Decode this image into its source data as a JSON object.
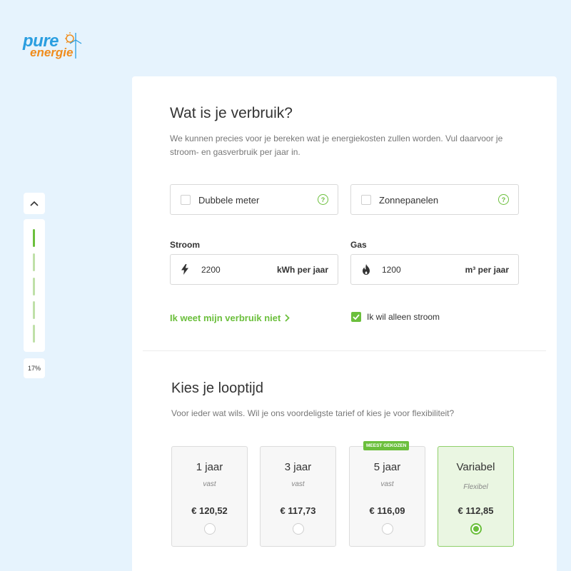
{
  "logo": {
    "line1": "pure",
    "line2": "energie"
  },
  "sidebar": {
    "up_icon": "chevron-up-icon",
    "progress_label": "17%",
    "progress_fraction": 0.17,
    "steps": 5
  },
  "usage": {
    "title": "Wat is je verbruik?",
    "description": "We kunnen precies voor je bereken wat je energiekosten zullen worden. Vul daarvoor je stroom- en gasverbruik per jaar in.",
    "double_meter_label": "Dubbele meter",
    "solar_panels_label": "Zonnepanelen",
    "help_icon_text": "?",
    "stroom": {
      "label": "Stroom",
      "value": "2200",
      "unit": "kWh per jaar",
      "icon": "lightning-icon"
    },
    "gas": {
      "label": "Gas",
      "value": "1200",
      "unit": "m³ per jaar",
      "icon": "flame-icon"
    },
    "unknown_usage_link": "Ik weet mijn verbruik niet",
    "only_electricity_label": "Ik wil alleen stroom",
    "only_electricity_checked": true
  },
  "term": {
    "title": "Kies je looptijd",
    "description": "Voor ieder wat wils. Wil je ons voordeligste tarief of kies je voor flexibiliteit?",
    "plans": [
      {
        "title": "1 jaar",
        "subtitle": "vast",
        "price": "€ 120,52",
        "selected": false
      },
      {
        "title": "3 jaar",
        "subtitle": "vast",
        "price": "€ 117,73",
        "selected": false
      },
      {
        "title": "5 jaar",
        "subtitle": "vast",
        "price": "€ 116,09",
        "selected": false,
        "badge": "MEEST GEKOZEN"
      },
      {
        "title": "Variabel",
        "subtitle": "Flexibel",
        "price": "€ 112,85",
        "selected": true
      }
    ]
  },
  "colors": {
    "background": "#e6f3fd",
    "accent_green": "#6bbf3c",
    "logo_blue": "#2a9ee0",
    "logo_orange": "#f08c1c"
  }
}
